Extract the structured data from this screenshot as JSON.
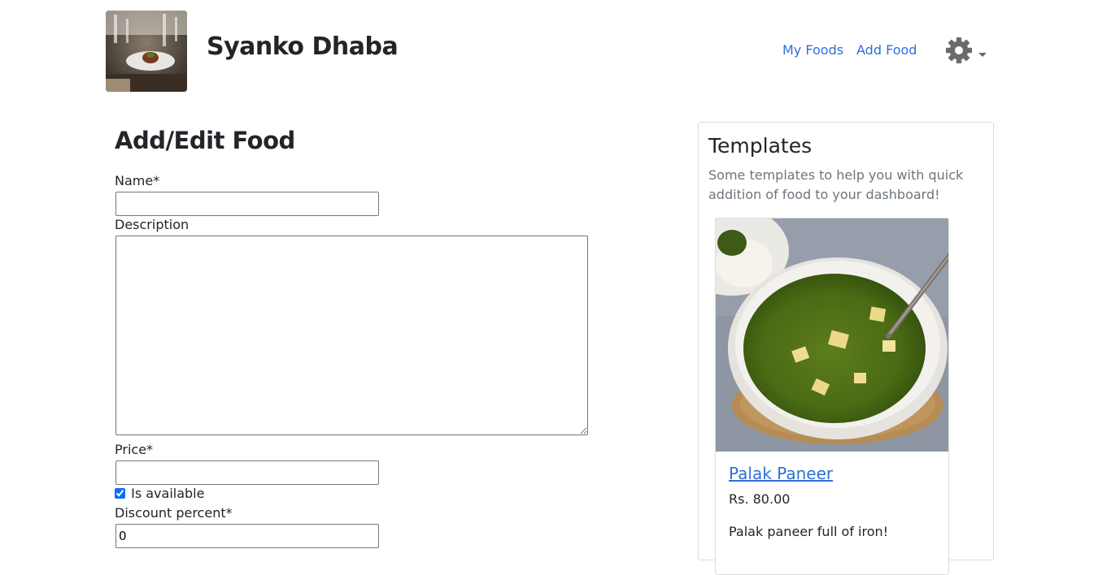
{
  "header": {
    "brand": "Syanko Dhaba",
    "nav": {
      "my_foods": "My Foods",
      "add_food": "Add Food"
    },
    "settings_icon": "gear-icon"
  },
  "form": {
    "title": "Add/Edit Food",
    "name": {
      "label": "Name*",
      "value": ""
    },
    "description": {
      "label": "Description",
      "value": ""
    },
    "price": {
      "label": "Price*",
      "value": ""
    },
    "is_available": {
      "label": "Is available",
      "checked": true
    },
    "discount": {
      "label": "Discount percent*",
      "value": "0"
    }
  },
  "templates": {
    "title": "Templates",
    "subtitle": "Some templates to help you with quick addition of food to your dashboard!",
    "items": [
      {
        "name": "Palak Paneer",
        "price": "Rs. 80.00",
        "description": "Palak paneer full of iron!"
      }
    ]
  },
  "colors": {
    "link": "#2f6fd6",
    "text": "#212529",
    "muted": "#6c757d",
    "border": "#dcdcdc"
  }
}
